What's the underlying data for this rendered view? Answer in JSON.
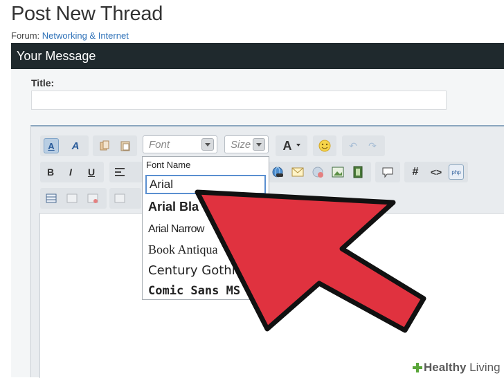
{
  "page": {
    "title": "Post New Thread"
  },
  "forum": {
    "prefix": "Forum:",
    "name": "Networking & Internet"
  },
  "section": {
    "title": "Your Message"
  },
  "title_field": {
    "label": "Title:",
    "value": ""
  },
  "toolbar": {
    "font_dropdown": "Font",
    "size_dropdown": "Size",
    "text_color": "A",
    "bold": "B",
    "italic": "I",
    "underline": "U",
    "hash": "#",
    "code": "<>",
    "php": "php"
  },
  "font_menu": {
    "header": "Font Name",
    "items": [
      "Arial",
      "Arial Bla",
      "Arial Narrow",
      "Book Antiqua",
      "Century Gothic",
      "Comic Sans MS"
    ],
    "selected": "Arial"
  },
  "watermark": {
    "brand_a": "Healthy",
    "brand_b": " Living"
  },
  "colors": {
    "section_bar": "#1f292d",
    "arrow_fill": "#e0323f",
    "link": "#2f72b8",
    "selection_border": "#5a8fd0"
  }
}
